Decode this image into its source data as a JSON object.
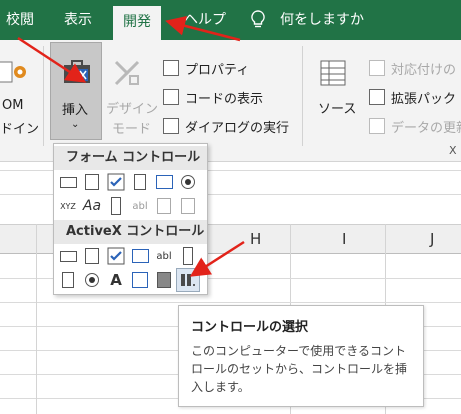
{
  "tabs": {
    "review": "校閲",
    "view": "表示",
    "developer": "開発",
    "help": "ヘルプ",
    "tellme": "何をしますか"
  },
  "ribbon": {
    "com_addins": "OM",
    "com_addins2": "ドイン",
    "insert": "挿入",
    "design_mode_1": "デザイン",
    "design_mode_2": "モード",
    "properties": "プロパティ",
    "view_code": "コードの表示",
    "run_dialog": "ダイアログの実行",
    "source": "ソース",
    "map_properties": "対応付けの",
    "expansion_packs": "拡張パック",
    "refresh_data": "データの更新",
    "group_label_x": "X"
  },
  "dropdown": {
    "form_controls_header": "フォーム コントロール",
    "activex_header": "ActiveX コントロール",
    "label_A": "A",
    "label_Aa": "Aa",
    "label_abl": "abl",
    "label_xyz": "XYZ"
  },
  "grid": {
    "col_h": "H",
    "col_i": "I",
    "col_j": "J"
  },
  "tooltip": {
    "title": "コントロールの選択",
    "body": "このコンピューターで使用できるコントロールのセットから、コントロールを挿入します。"
  },
  "colors": {
    "tab_bar": "#217346",
    "annotation_arrow": "#e2231a",
    "checkbox_blue": "#2b63b8"
  }
}
